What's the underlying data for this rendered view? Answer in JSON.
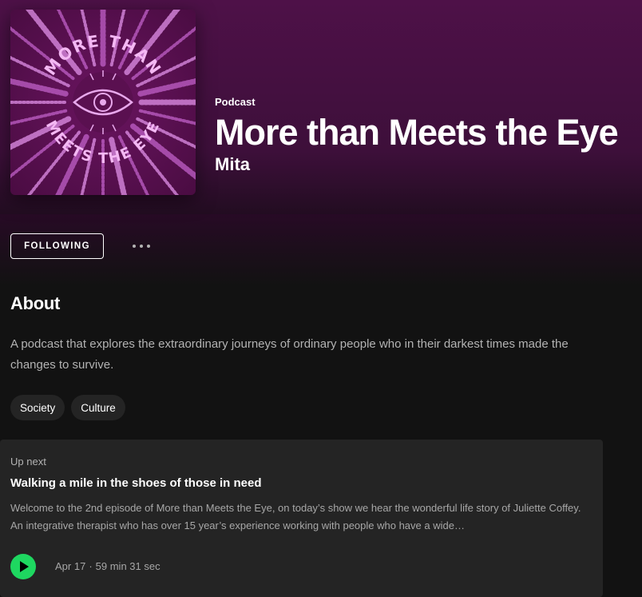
{
  "podcast": {
    "kind_label": "Podcast",
    "title": "More than Meets the Eye",
    "author": "Mita",
    "cover": {
      "top_text": "MORE THAN",
      "bottom_text": "MEETS THE EYE",
      "bg_color": "#5a1050",
      "ray_color": "#d070d8",
      "accent_color": "#f0b0f0"
    }
  },
  "actions": {
    "follow_label": "FOLLOWING",
    "more_icon": "more-horizontal-icon"
  },
  "about": {
    "heading": "About",
    "description": "A podcast that explores the extraordinary journeys of ordinary people who in their darkest times made the changes to survive.",
    "tags": [
      "Society",
      "Culture"
    ]
  },
  "up_next": {
    "label": "Up next",
    "episode_title": "Walking a mile in the shoes of those in need",
    "episode_description": "Welcome to the 2nd episode of More than Meets the Eye, on today’s show we hear the wonderful life story of Juliette Coffey.  An integrative therapist who has over 15 year’s experience working with people who have a wide…",
    "date": "Apr 17",
    "separator": "·",
    "duration": "59 min 31 sec",
    "play_icon": "play-icon"
  },
  "colors": {
    "accent_green": "#1ed760",
    "background": "#121212",
    "hero_purple": "#4e1148"
  }
}
